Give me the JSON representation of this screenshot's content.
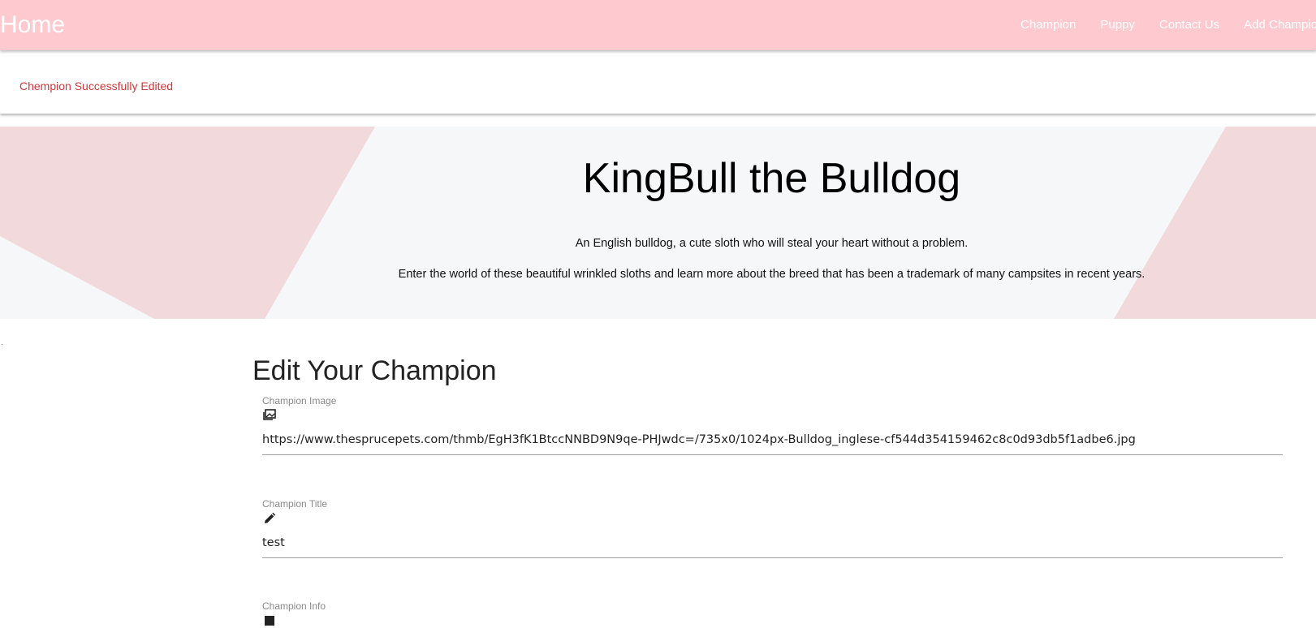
{
  "navbar": {
    "brand": "Home",
    "links": [
      "Champion",
      "Puppy",
      "Contact Us",
      "Add Champion"
    ]
  },
  "flash": {
    "message": "Chempion Successfully Edited"
  },
  "hero": {
    "title": "KingBull the Bulldog",
    "paragraph1": "An English bulldog, a cute sloth who will steal your heart without a problem.",
    "paragraph2": "Enter the world of these beautiful wrinkled sloths and learn more about the breed that has been a trademark of many campsites in recent years."
  },
  "form": {
    "title": "Edit Your Champion",
    "image": {
      "label": "Champion Image",
      "icon": "image-icon",
      "value": "https://www.thesprucepets.com/thmb/EgH3fK1BtccNNBD9N9qe-PHJwdc=/735x0/1024px-Bulldog_inglese-cf544d354159462c8c0d93db5f1adbe6.jpg"
    },
    "title_field": {
      "label": "Champion Title",
      "icon": "pencil-icon",
      "value": "test"
    },
    "info": {
      "label": "Champion Info",
      "icon": "info-icon"
    }
  },
  "colors": {
    "navbar_bg": "#ffc9d0",
    "flash_text": "#d03838",
    "hero_bg": "#f6f7f8",
    "hero_shape": "#f2d9dc"
  }
}
